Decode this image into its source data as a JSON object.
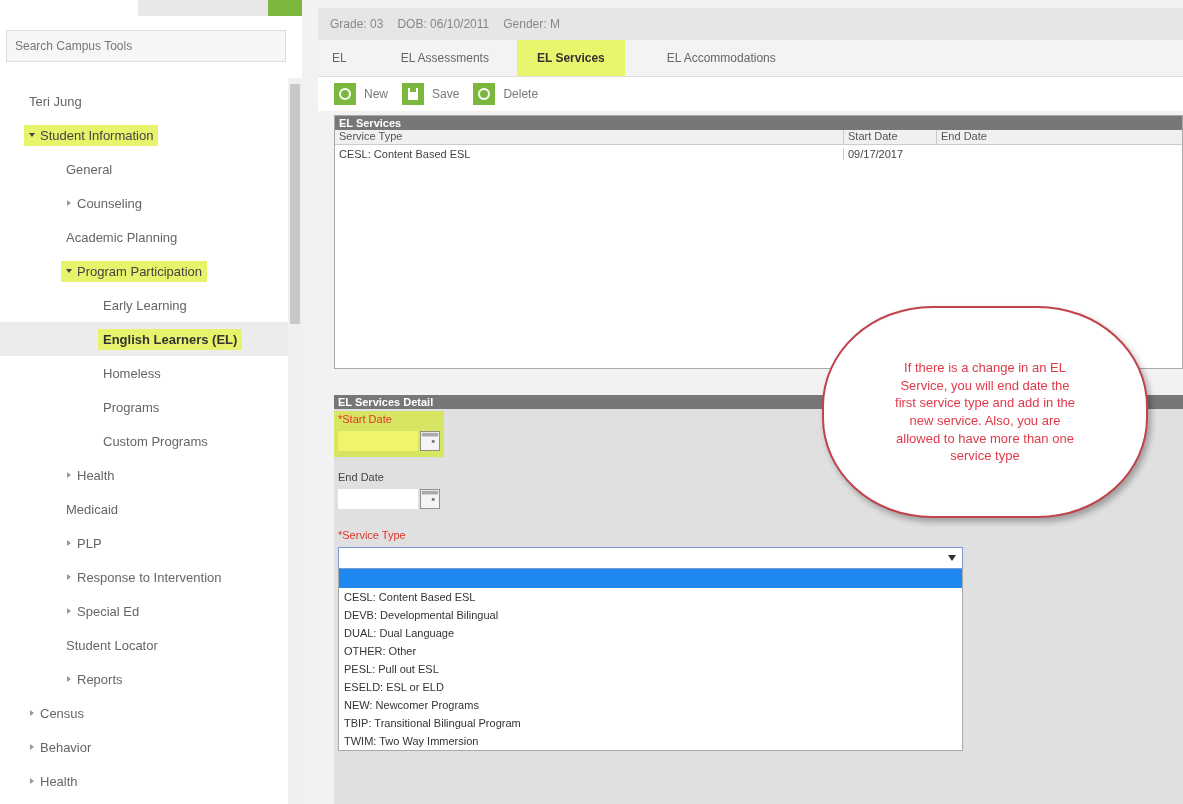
{
  "sidebar": {
    "search": {
      "placeholder": "Search Campus Tools"
    },
    "tree": [
      {
        "label": "Teri Jung",
        "highlighted": false,
        "selected": false
      },
      {
        "label": "Student Information",
        "expanded": true,
        "highlighted": true,
        "selected": false,
        "children": [
          {
            "label": "General",
            "highlighted": false,
            "selected": false
          },
          {
            "label": "Counseling",
            "expanded": false,
            "highlighted": false,
            "selected": false
          },
          {
            "label": "Academic Planning",
            "highlighted": false,
            "selected": false
          },
          {
            "label": "Program Participation",
            "expanded": true,
            "highlighted": true,
            "selected": false,
            "children": [
              {
                "label": "Early Learning",
                "highlighted": false,
                "selected": false
              },
              {
                "label": "English Learners (EL)",
                "highlighted": true,
                "selected": true
              },
              {
                "label": "Homeless",
                "highlighted": false,
                "selected": false
              },
              {
                "label": "Programs",
                "highlighted": false,
                "selected": false
              },
              {
                "label": "Custom Programs",
                "highlighted": false,
                "selected": false
              }
            ]
          },
          {
            "label": "Health",
            "expanded": false,
            "highlighted": false,
            "selected": false
          },
          {
            "label": "Medicaid",
            "highlighted": false,
            "selected": false
          },
          {
            "label": "PLP",
            "expanded": false,
            "highlighted": false,
            "selected": false
          },
          {
            "label": "Response to Intervention",
            "expanded": false,
            "highlighted": false,
            "selected": false
          },
          {
            "label": "Special Ed",
            "expanded": false,
            "highlighted": false,
            "selected": false
          },
          {
            "label": "Student Locator",
            "highlighted": false,
            "selected": false
          },
          {
            "label": "Reports",
            "expanded": false,
            "highlighted": false,
            "selected": false
          }
        ]
      },
      {
        "label": "Census",
        "expanded": false,
        "highlighted": false,
        "selected": false
      },
      {
        "label": "Behavior",
        "expanded": false,
        "highlighted": false,
        "selected": false
      },
      {
        "label": "Health",
        "expanded": false,
        "highlighted": false,
        "selected": false
      }
    ]
  },
  "student_bar": [
    "Grade: 03",
    "DOB: 06/10/2011",
    "Gender: M"
  ],
  "tabs": [
    {
      "label": "EL",
      "selected": false
    },
    {
      "label": "EL Assessments",
      "selected": false
    },
    {
      "label": "EL Services",
      "selected": true
    },
    {
      "label": "EL Accommodations",
      "selected": false
    }
  ],
  "toolbar": [
    {
      "label": "New",
      "kind": "new"
    },
    {
      "label": "Save",
      "kind": "save"
    },
    {
      "label": "Delete",
      "kind": "delete"
    }
  ],
  "services_table": {
    "title": "EL Services",
    "columns": [
      "Service Type",
      "Start Date",
      "End Date"
    ],
    "rows": [
      [
        "CESL: Content Based ESL",
        "09/17/2017"
      ]
    ]
  },
  "detail": {
    "title": "EL Services Detail",
    "fields": [
      {
        "label": "*Start Date",
        "kind": "date",
        "required": true,
        "highlighted": true
      },
      {
        "label": "End Date",
        "kind": "date",
        "required": false,
        "highlighted": false
      },
      {
        "label": "*Service Type",
        "kind": "select",
        "required": true,
        "highlighted": false,
        "expanded": true,
        "options": [
          {
            "selected": true
          },
          {
            "label": "CESL: Content Based ESL",
            "selected": false
          },
          {
            "label": "DEVB: Developmental Bilingual",
            "selected": false
          },
          {
            "label": "DUAL: Dual Language",
            "selected": false
          },
          {
            "label": "OTHER: Other",
            "selected": false
          },
          {
            "label": "PESL: Pull out ESL",
            "selected": false
          },
          {
            "label": "ESELD: ESL or ELD",
            "selected": false
          },
          {
            "label": "NEW: Newcomer Programs",
            "selected": false
          },
          {
            "label": "TBIP: Transitional Bilingual Program",
            "selected": false
          },
          {
            "label": "TWIM: Two Way Immersion",
            "selected": false
          }
        ]
      }
    ]
  },
  "callout": "If there is a change in an EL Service, you will end date the first service type and add in the new service.  Also, you are allowed to have more than one service type"
}
